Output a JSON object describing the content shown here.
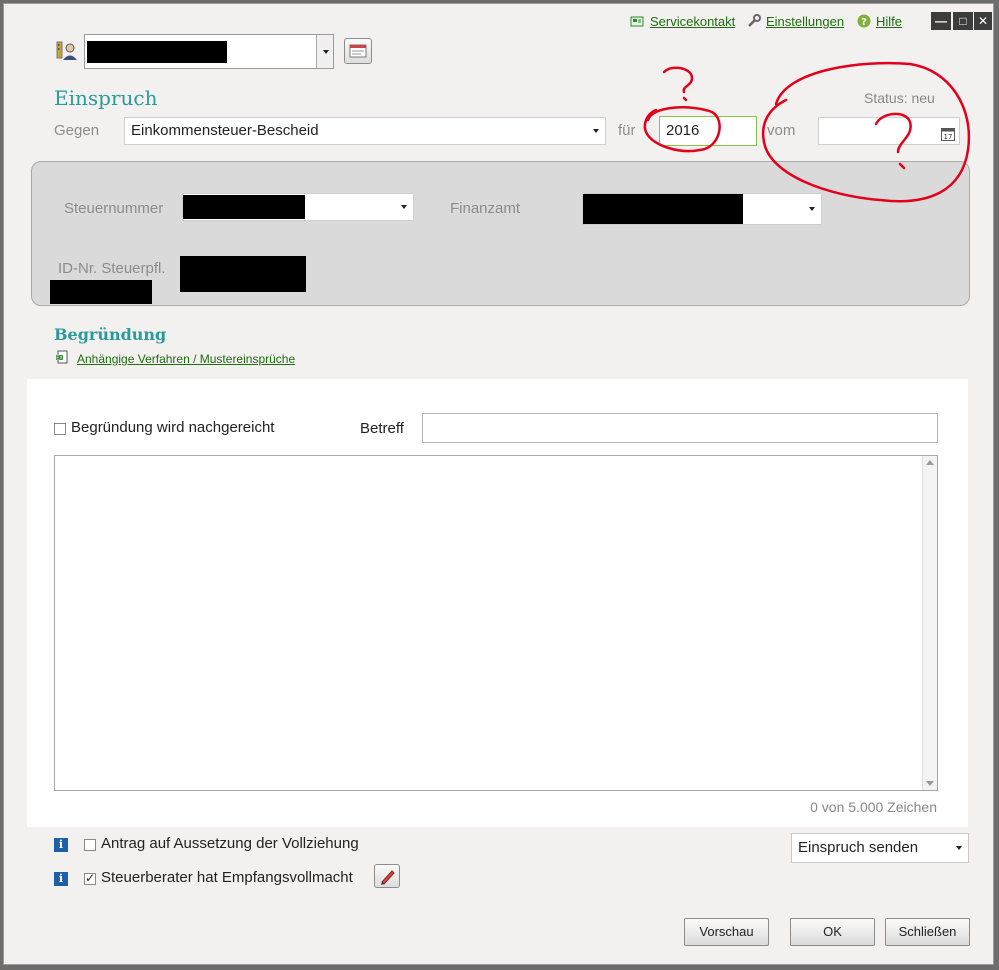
{
  "top_links": {
    "service": "Servicekontakt",
    "settings": "Einstellungen",
    "help": "Hilfe"
  },
  "header": {
    "title": "Einspruch",
    "status": "Status: neu",
    "against_label": "Gegen",
    "against_value": "Einkommensteuer-Bescheid",
    "for_label": "für",
    "year_value": "2016",
    "from_label": "vom",
    "from_value": ""
  },
  "panel": {
    "tax_number_label": "Steuernummer",
    "tax_office_label": "Finanzamt",
    "id_label": "ID-Nr. Steuerpfl."
  },
  "reason": {
    "title": "Begründung",
    "link": "Anhängige Verfahren / Mustereinsprüche",
    "checkbox_label": "Begründung wird nachgereicht",
    "checkbox_checked": false,
    "subject_label": "Betreff",
    "subject_value": "",
    "text_value": "",
    "char_count": "0 von 5.000 Zeichen"
  },
  "options": {
    "suspension_label": "Antrag auf Aussetzung der Vollziehung",
    "suspension_checked": false,
    "advisor_label": "Steuerberater hat Empfangsvollmacht",
    "advisor_checked": true,
    "send_select_value": "Einspruch senden"
  },
  "buttons": {
    "preview": "Vorschau",
    "ok": "OK",
    "close": "Schließen"
  },
  "annotation": {
    "color": "#e3001b"
  }
}
